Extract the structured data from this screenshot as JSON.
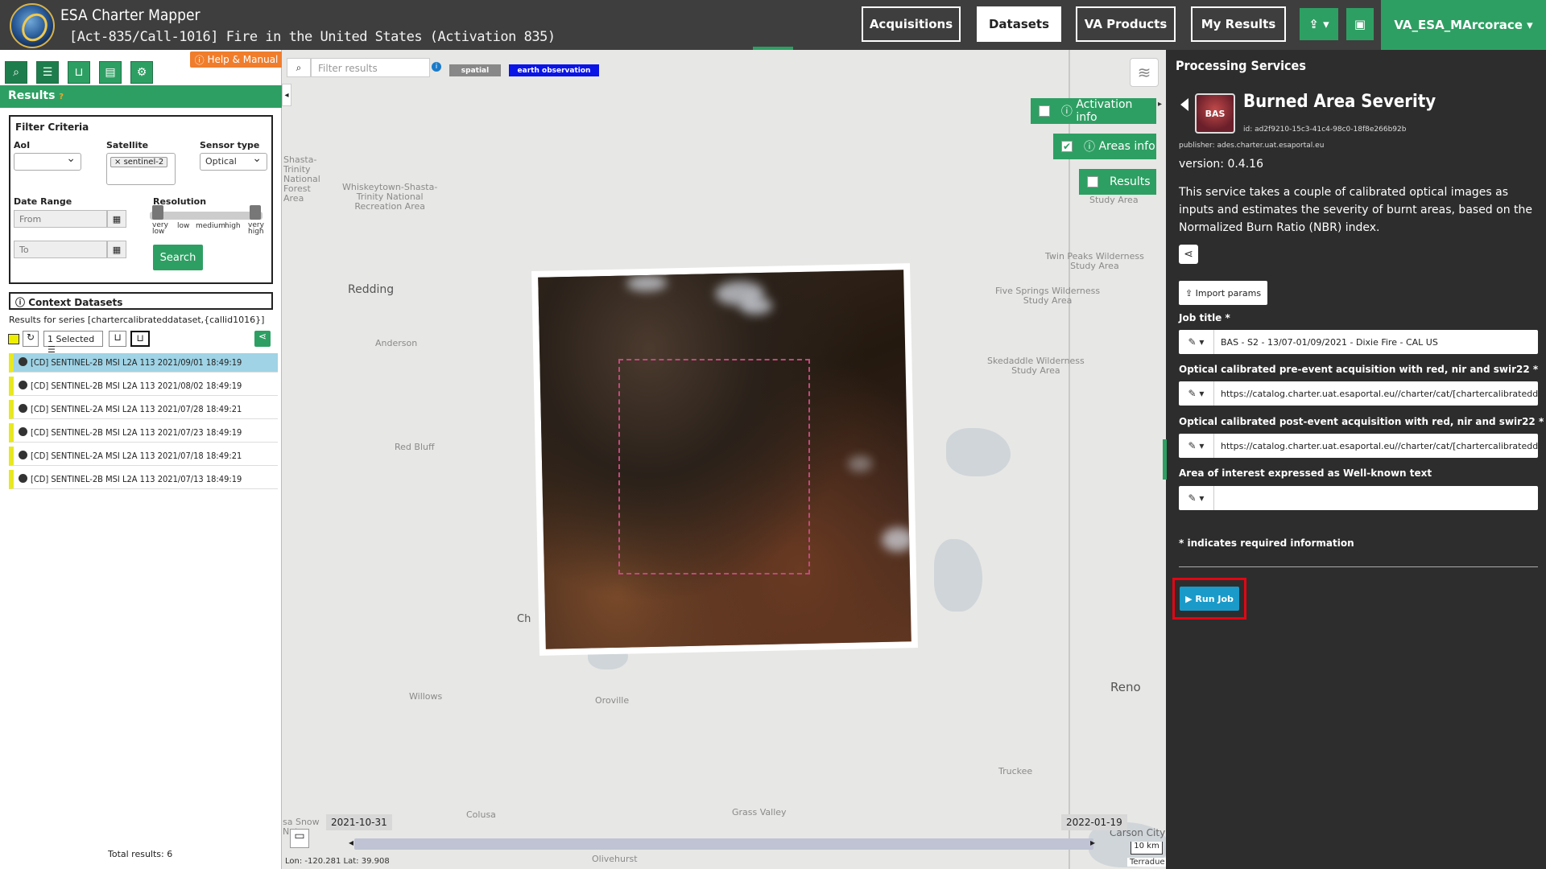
{
  "header": {
    "app_title": "ESA Charter Mapper",
    "activation_title": "[Act-835/Call-1016] Fire in the United States (Activation 835)",
    "nav": [
      "Acquisitions",
      "Datasets",
      "VA Products",
      "My Results"
    ],
    "upload_icon": "upload-icon",
    "briefcase_icon": "briefcase-icon",
    "user": "VA_ESA_MArcorace"
  },
  "left": {
    "help_label": "Help & Manual",
    "results_label": "Results",
    "filter": {
      "title": "Filter Criteria",
      "aoi_label": "AoI",
      "satellite_label": "Satellite",
      "satellite_tag": "sentinel-2",
      "sensor_label": "Sensor type",
      "sensor_value": "Optical",
      "date_label": "Date Range",
      "from_placeholder": "From",
      "to_placeholder": "To",
      "resolution_label": "Resolution",
      "res_levels": [
        "very low",
        "low",
        "medium",
        "high",
        "very high"
      ],
      "search_label": "Search"
    },
    "context_label": "Context Datasets",
    "series_text": "Results for series [chartercalibrateddataset,{callid1016}]",
    "selected_label": "1 Selected",
    "items": [
      "[CD] SENTINEL-2B MSI L2A 113 2021/09/01 18:49:19",
      "[CD] SENTINEL-2B MSI L2A 113 2021/08/02 18:49:19",
      "[CD] SENTINEL-2A MSI L2A 113 2021/07/28 18:49:21",
      "[CD] SENTINEL-2B MSI L2A 113 2021/07/23 18:49:19",
      "[CD] SENTINEL-2A MSI L2A 113 2021/07/18 18:49:21",
      "[CD] SENTINEL-2B MSI L2A 113 2021/07/13 18:49:19"
    ],
    "total": "Total results: 6"
  },
  "map": {
    "filter_placeholder": "Filter results",
    "tag_spatial": "spatial",
    "tag_eo": "earth observation",
    "activation_info": "Activation info",
    "areas_info": "Areas info",
    "results_label": "Results",
    "labels": {
      "shasta": "Shasta-\nTrinity\nNational\nForest\nArea",
      "whiskey": "Whiskeytown-Shasta-\nTrinity National\nRecreation Area",
      "redding": "Redding",
      "anderson": "Anderson",
      "redbluff": "Red Bluff",
      "willows": "Willows",
      "oroville": "Oroville",
      "colusa": "Colusa",
      "grass": "Grass Valley",
      "truckee": "Truckee",
      "reno": "Reno",
      "carson": "Carson City",
      "olivehurst": "Olivehurst",
      "twin": "Twin Peaks Wilderness\nStudy Area",
      "five": "Five Springs Wilderness\nStudy Area",
      "skedaddle": "Skedaddle Wilderness\nStudy Area",
      "study": "Study Area",
      "ch": "Ch",
      "snow": "sa Snow\nNat"
    },
    "date_start": "2021-10-31",
    "date_end": "2022-01-19",
    "coords": "Lon: -120.281 Lat: 39.908",
    "scale": "10 km",
    "attribution": "Terradue"
  },
  "right": {
    "heading": "Processing Services",
    "service_badge": "BAS",
    "service_title": "Burned Area Severity",
    "service_id": "id: ad2f9210-15c3-41c4-98c0-18f8e266b92b",
    "publisher": "publisher: ades.charter.uat.esaportal.eu",
    "version": "version: 0.4.16",
    "description": "This service takes a couple of calibrated optical images as inputs and estimates the severity of burnt areas, based on the Normalized Burn Ratio (NBR) index.",
    "import_label": "Import params",
    "fields": [
      {
        "label": "Job title *",
        "value": "BAS - S2 - 13/07-01/09/2021 - Dixie Fire - CAL US"
      },
      {
        "label": "Optical calibrated pre-event acquisition with red, nir and swir22 *",
        "value": "https://catalog.charter.uat.esaportal.eu//charter/cat/[chartercalibrateddataset,{ca"
      },
      {
        "label": "Optical calibrated post-event acquisition with red, nir and swir22 *",
        "value": "https://catalog.charter.uat.esaportal.eu//charter/cat/[chartercalibrateddataset,{ca"
      },
      {
        "label": "Area of interest expressed as Well-known text",
        "value": ""
      }
    ],
    "required_note": "* indicates required information",
    "run_label": "Run Job"
  }
}
